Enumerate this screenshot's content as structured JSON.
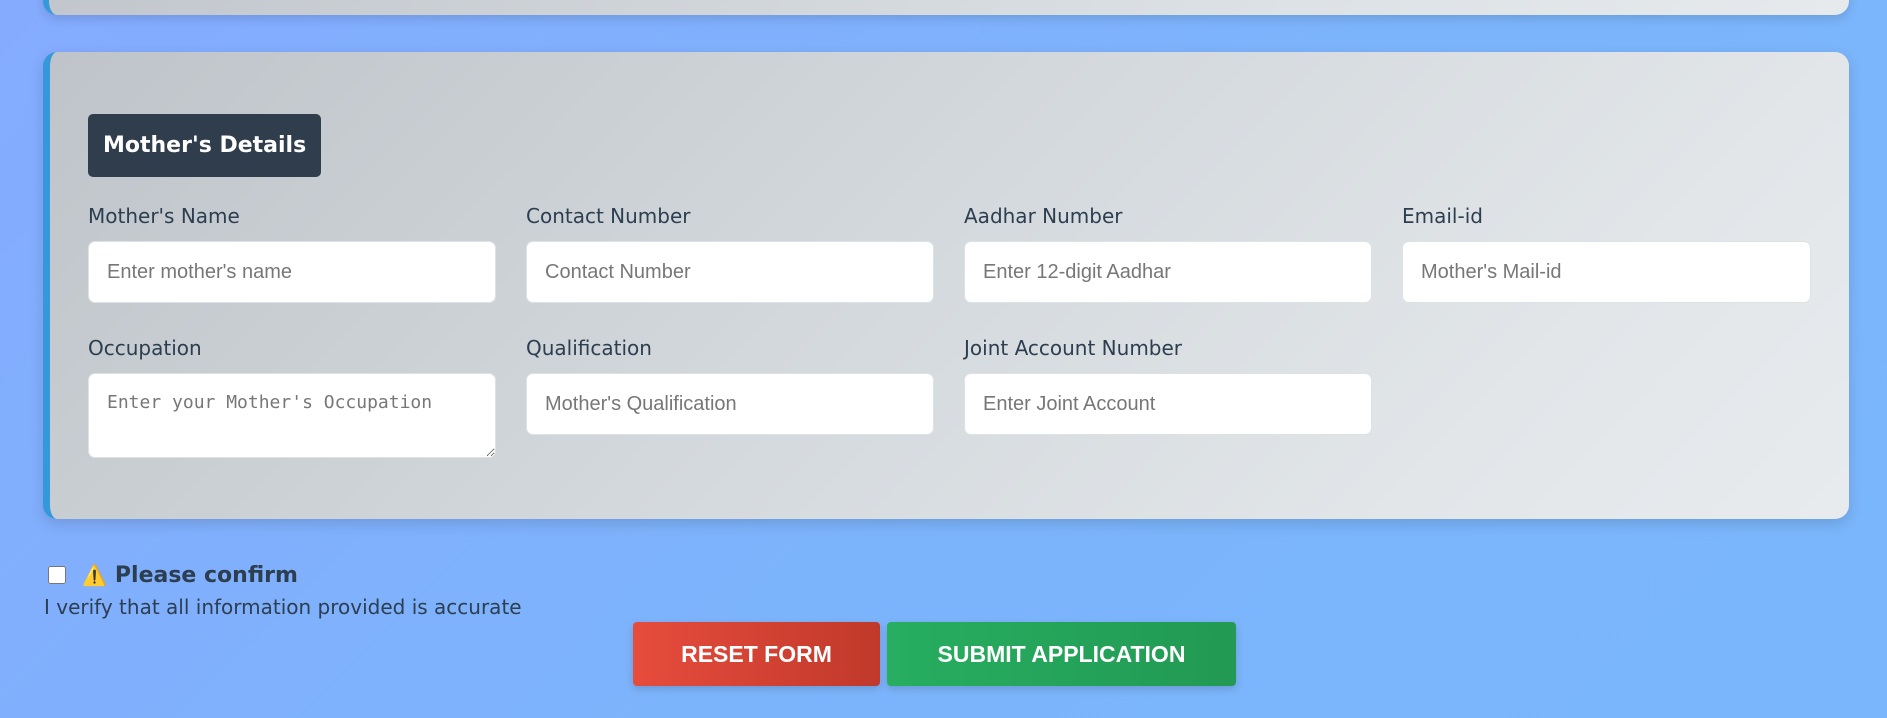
{
  "section": {
    "title": "Mother's Details"
  },
  "fields": {
    "mother_name": {
      "label": "Mother's Name",
      "placeholder": "Enter mother's name"
    },
    "contact": {
      "label": "Contact Number",
      "placeholder": "Contact Number"
    },
    "aadhar": {
      "label": "Aadhar Number",
      "placeholder": "Enter 12-digit Aadhar"
    },
    "email": {
      "label": "Email-id",
      "placeholder": "Mother's Mail-id"
    },
    "occupation": {
      "label": "Occupation",
      "placeholder": "Enter your Mother's Occupation"
    },
    "qualification": {
      "label": "Qualification",
      "placeholder": "Mother's Qualification"
    },
    "joint_account": {
      "label": "Joint Account Number",
      "placeholder": "Enter Joint Account"
    }
  },
  "confirm": {
    "icon": "⚠️",
    "title": "Please confirm",
    "text": "I verify that all information provided is accurate"
  },
  "buttons": {
    "reset": "RESET FORM",
    "submit": "SUBMIT APPLICATION"
  },
  "colors": {
    "accent": "#3498db",
    "section_title_bg": "#2f3d4c",
    "reset": "#e74c3c",
    "submit": "#27ae60",
    "text": "#2c3e50"
  }
}
